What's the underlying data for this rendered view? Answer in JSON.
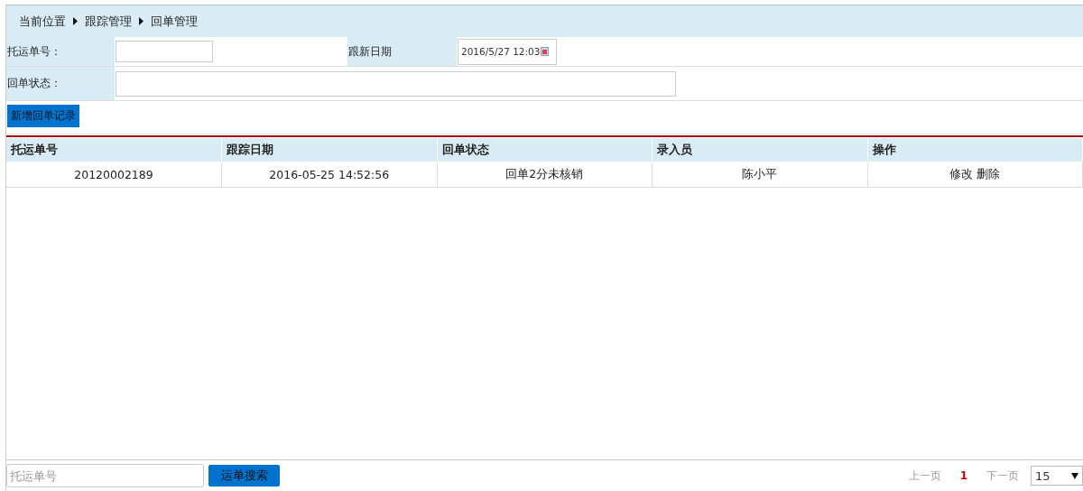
{
  "breadcrumb": {
    "label": "当前位置",
    "items": [
      "跟踪管理",
      "回单管理"
    ]
  },
  "form": {
    "fields": [
      {
        "kind": "text",
        "label": "托运单号："
      },
      {
        "kind": "date",
        "label": "跟新日期",
        "value": "2016/5/27 12:03"
      },
      {
        "kind": "wide",
        "label": "回单状态："
      }
    ],
    "add_button": "新增回单记录"
  },
  "table": {
    "columns": [
      "托运单号",
      "跟踪日期",
      "回单状态",
      "录入员",
      "操作"
    ],
    "rows": [
      {
        "cells": [
          "20120002189",
          "2016-05-25 14:52:56",
          "回单2分未核销",
          "陈小平"
        ],
        "actions": [
          "修改",
          "删除"
        ]
      }
    ]
  },
  "footer": {
    "search": {
      "placeholder": "托运单号"
    },
    "search_button": "运单搜索",
    "pager": {
      "prev": "上一页",
      "pages": [
        {
          "label": "1",
          "selected": true
        }
      ],
      "next": "下一页",
      "page_size": "15"
    }
  }
}
